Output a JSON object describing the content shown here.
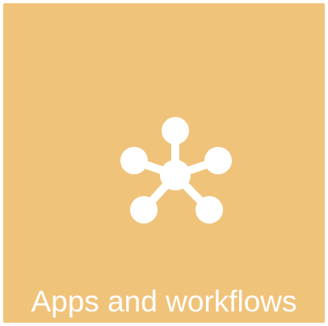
{
  "tile": {
    "label": "Apps and workflows",
    "icon": "network-hub-icon",
    "background_color": "#F0C37B",
    "foreground_color": "#FFFFFF"
  }
}
